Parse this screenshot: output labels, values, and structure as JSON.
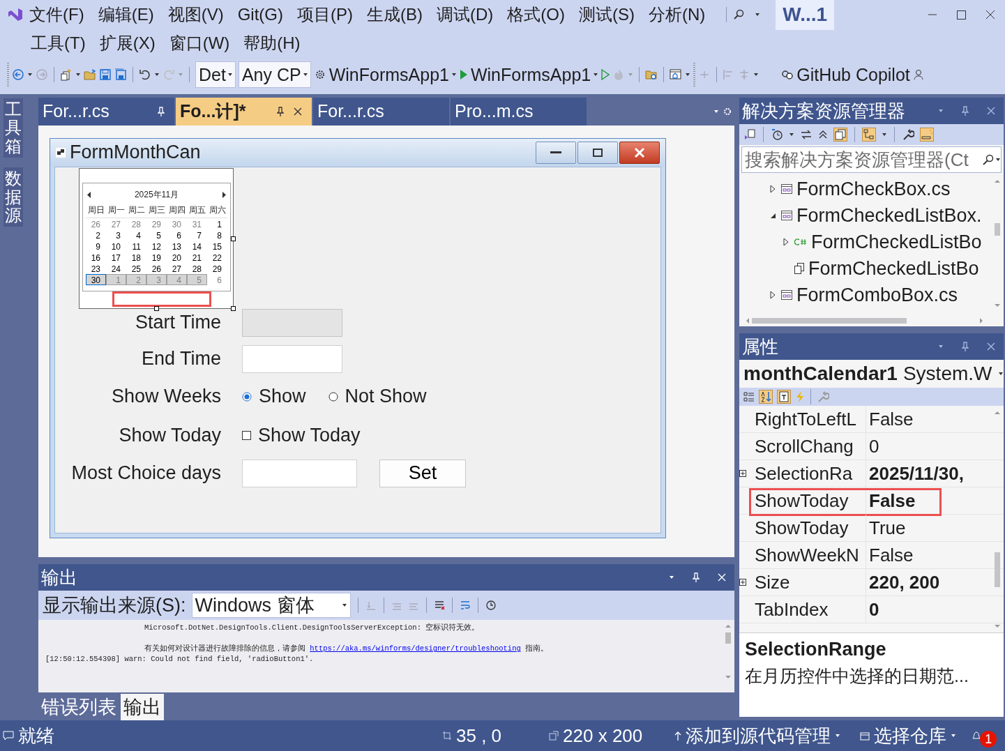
{
  "title_box": "W...1",
  "menu_rows": [
    [
      "文件(F)",
      "编辑(E)",
      "视图(V)",
      "Git(G)",
      "项目(P)",
      "生成(B)",
      "调试(D)",
      "格式(O)",
      "测试(S)",
      "分析(N)"
    ],
    [
      "工具(T)",
      "扩展(X)",
      "窗口(W)",
      "帮助(H)"
    ]
  ],
  "toolbar": {
    "configuration": "Det",
    "platform": "Any CP",
    "startup_project": "WinFormsApp1",
    "run_target": "WinFormsApp1",
    "copilot": "GitHub Copilot"
  },
  "side_tabs": [
    "工具箱",
    "数据源"
  ],
  "editor_tabs": [
    {
      "label": "For...r.cs",
      "selected": false,
      "pinned": true
    },
    {
      "label": "Fo...计]*",
      "selected": true,
      "pinned": true
    },
    {
      "label": "For...r.cs",
      "selected": false,
      "pinned": false
    },
    {
      "label": "Pro...m.cs",
      "selected": false,
      "pinned": false
    }
  ],
  "designer": {
    "form_title": "FormMonthCan",
    "annotation_box": true,
    "calendar": {
      "month": "2025年11月",
      "weekdays": [
        "周日",
        "周一",
        "周二",
        "周三",
        "周四",
        "周五",
        "周六"
      ],
      "weeks": [
        [
          {
            "label": "26",
            "muted": true,
            "selected": false,
            "focused": false
          },
          {
            "label": "27",
            "muted": true,
            "selected": false,
            "focused": false
          },
          {
            "label": "28",
            "muted": true,
            "selected": false,
            "focused": false
          },
          {
            "label": "29",
            "muted": true,
            "selected": false,
            "focused": false
          },
          {
            "label": "30",
            "muted": true,
            "selected": false,
            "focused": false
          },
          {
            "label": "31",
            "muted": true,
            "selected": false,
            "focused": false
          },
          {
            "label": "1",
            "muted": false,
            "selected": false,
            "focused": false
          }
        ],
        [
          {
            "label": "2",
            "muted": false,
            "selected": false,
            "focused": false
          },
          {
            "label": "3",
            "muted": false,
            "selected": false,
            "focused": false
          },
          {
            "label": "4",
            "muted": false,
            "selected": false,
            "focused": false
          },
          {
            "label": "5",
            "muted": false,
            "selected": false,
            "focused": false
          },
          {
            "label": "6",
            "muted": false,
            "selected": false,
            "focused": false
          },
          {
            "label": "7",
            "muted": false,
            "selected": false,
            "focused": false
          },
          {
            "label": "8",
            "muted": false,
            "selected": false,
            "focused": false
          }
        ],
        [
          {
            "label": "9",
            "muted": false,
            "selected": false,
            "focused": false
          },
          {
            "label": "10",
            "muted": false,
            "selected": false,
            "focused": false
          },
          {
            "label": "11",
            "muted": false,
            "selected": false,
            "focused": false
          },
          {
            "label": "12",
            "muted": false,
            "selected": false,
            "focused": false
          },
          {
            "label": "13",
            "muted": false,
            "selected": false,
            "focused": false
          },
          {
            "label": "14",
            "muted": false,
            "selected": false,
            "focused": false
          },
          {
            "label": "15",
            "muted": false,
            "selected": false,
            "focused": false
          }
        ],
        [
          {
            "label": "16",
            "muted": false,
            "selected": false,
            "focused": false
          },
          {
            "label": "17",
            "muted": false,
            "selected": false,
            "focused": false
          },
          {
            "label": "18",
            "muted": false,
            "selected": false,
            "focused": false
          },
          {
            "label": "19",
            "muted": false,
            "selected": false,
            "focused": false
          },
          {
            "label": "20",
            "muted": false,
            "selected": false,
            "focused": false
          },
          {
            "label": "21",
            "muted": false,
            "selected": false,
            "focused": false
          },
          {
            "label": "22",
            "muted": false,
            "selected": false,
            "focused": false
          }
        ],
        [
          {
            "label": "23",
            "muted": false,
            "selected": false,
            "focused": false
          },
          {
            "label": "24",
            "muted": false,
            "selected": false,
            "focused": false
          },
          {
            "label": "25",
            "muted": false,
            "selected": false,
            "focused": false
          },
          {
            "label": "26",
            "muted": false,
            "selected": false,
            "focused": false
          },
          {
            "label": "27",
            "muted": false,
            "selected": false,
            "focused": false
          },
          {
            "label": "28",
            "muted": false,
            "selected": false,
            "focused": false
          },
          {
            "label": "29",
            "muted": false,
            "selected": false,
            "focused": false
          }
        ],
        [
          {
            "label": "30",
            "muted": false,
            "selected": true,
            "focused": true
          },
          {
            "label": "1",
            "muted": true,
            "selected": true,
            "focused": false
          },
          {
            "label": "2",
            "muted": true,
            "selected": true,
            "focused": false
          },
          {
            "label": "3",
            "muted": true,
            "selected": true,
            "focused": false
          },
          {
            "label": "4",
            "muted": true,
            "selected": true,
            "focused": false
          },
          {
            "label": "5",
            "muted": true,
            "selected": true,
            "focused": false
          },
          {
            "label": "6",
            "muted": true,
            "selected": false,
            "focused": false
          }
        ]
      ]
    },
    "fields": [
      {
        "kind": "text",
        "label": "Start Time",
        "disabled": true
      },
      {
        "kind": "text",
        "label": "End Time",
        "disabled": false
      },
      {
        "kind": "radio",
        "label": "Show Weeks",
        "options": [
          {
            "label": "Show",
            "selected": true
          },
          {
            "label": "Not Show",
            "selected": false
          }
        ]
      },
      {
        "kind": "check",
        "label": "Show Today",
        "option": "Show Today",
        "checked": false
      },
      {
        "kind": "text_button",
        "label": "Most Choice days",
        "disabled": false,
        "button": "Set"
      }
    ]
  },
  "solution_explorer": {
    "title": "解决方案资源管理器",
    "search_placeholder": "搜索解决方案资源管理器(Ct",
    "items": [
      {
        "label": "FormCheckBox.cs",
        "kind": "form",
        "expandable": true,
        "expanded": false
      },
      {
        "label": "FormCheckedListBox.",
        "kind": "form",
        "expandable": true,
        "expanded": true,
        "children": [
          {
            "label": "FormCheckedListBo",
            "kind": "csharp",
            "expandable": true,
            "expanded": false
          },
          {
            "label": "FormCheckedListBo",
            "kind": "resource",
            "expandable": false
          }
        ]
      },
      {
        "label": "FormComboBox.cs",
        "kind": "form",
        "expandable": true,
        "expanded": false
      }
    ]
  },
  "properties": {
    "title": "属性",
    "object_name": "monthCalendar1",
    "object_type": "System.W",
    "rows": [
      {
        "name": "RightToLeftL",
        "value": "False",
        "bold": false,
        "expandable": false,
        "highlighted": false
      },
      {
        "name": "ScrollChang",
        "value": "0",
        "bold": false,
        "expandable": false,
        "highlighted": false
      },
      {
        "name": "SelectionRa",
        "value": "2025/11/30,",
        "bold": true,
        "expandable": true,
        "highlighted": false
      },
      {
        "name": "ShowToday",
        "value": "False",
        "bold": true,
        "expandable": false,
        "highlighted": true
      },
      {
        "name": "ShowToday",
        "value": "True",
        "bold": false,
        "expandable": false,
        "highlighted": false
      },
      {
        "name": "ShowWeekN",
        "value": "False",
        "bold": false,
        "expandable": false,
        "highlighted": false
      },
      {
        "name": "Size",
        "value": "220, 200",
        "bold": true,
        "expandable": true,
        "highlighted": false
      },
      {
        "name": "TabIndex",
        "value": "0",
        "bold": true,
        "expandable": false,
        "highlighted": false
      }
    ],
    "description_title": "SelectionRange",
    "description": "在月历控件中选择的日期范..."
  },
  "output": {
    "title": "输出",
    "source_label": "显示输出来源(S):",
    "source": "Windows 窗体",
    "lines": [
      {
        "kind": "message",
        "text": "Microsoft.DotNet.DesignTools.Client.DesignToolsServerException: 空标识符无效。"
      },
      {
        "kind": "blank"
      },
      {
        "kind": "message",
        "text": "有关如何对设计器进行故障排除的信息，请参阅 ",
        "link": "https://aka.ms/winforms/designer/troubleshooting",
        "after": " 指南。"
      },
      {
        "kind": "log",
        "text": "[12:50:12.554398] warn: Could not find field, 'radioButton1'."
      }
    ]
  },
  "bottom_tabs": [
    {
      "label": "错误列表",
      "selected": false
    },
    {
      "label": "输出",
      "selected": true
    }
  ],
  "status_bar": {
    "message": "就绪",
    "position": "35 , 0",
    "size": "220 x 200",
    "source_control": "添加到源代码管理",
    "repository": "选择仓库",
    "notifications": "1"
  }
}
